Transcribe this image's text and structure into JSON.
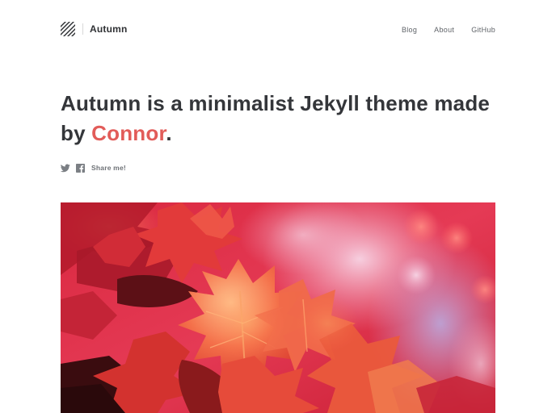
{
  "site": {
    "name": "Autumn",
    "logo_icon": "striped-logo-icon"
  },
  "nav": {
    "items": [
      {
        "label": "Blog"
      },
      {
        "label": "About"
      },
      {
        "label": "GitHub"
      }
    ]
  },
  "hero": {
    "title_prefix": "Autumn is a minimalist Jekyll theme made by ",
    "title_link": "Connor",
    "title_suffix": ".",
    "accent_color": "#e25c59"
  },
  "share": {
    "twitter_icon": "twitter-icon",
    "facebook_icon": "facebook-icon",
    "label": "Share me!"
  },
  "feature_image": {
    "subject": "red-autumn-leaves-photo"
  }
}
